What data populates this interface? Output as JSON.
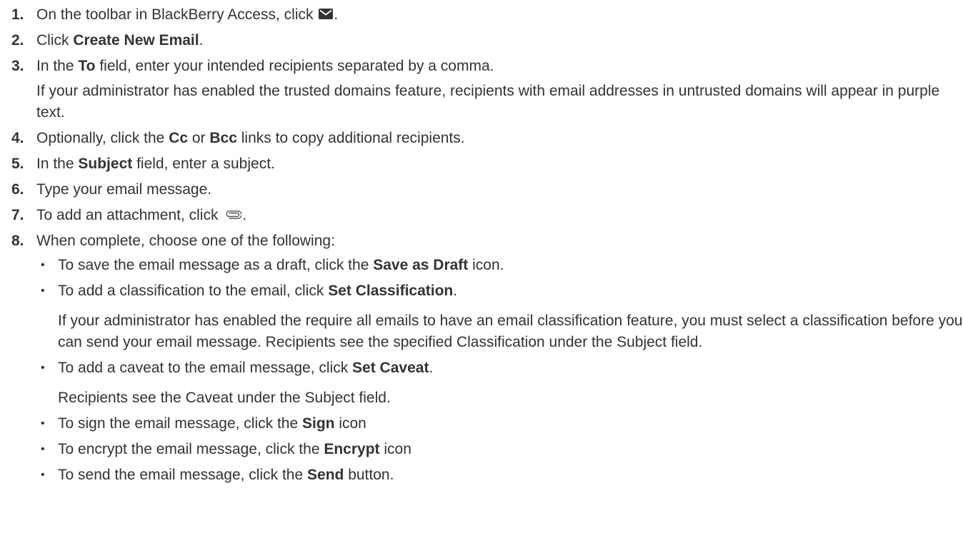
{
  "steps": [
    {
      "num": "1.",
      "a": "On the toolbar in BlackBerry Access, click ",
      "icon": "mail-icon",
      "b": "."
    },
    {
      "num": "2.",
      "a": "Click ",
      "bold1": "Create New Email",
      "b": "."
    },
    {
      "num": "3.",
      "a": "In the ",
      "bold1": "To",
      "b": " field, enter your intended recipients separated by a comma.",
      "note": "If your administrator has enabled the trusted domains feature, recipients with email addresses in untrusted domains will appear in purple text."
    },
    {
      "num": "4.",
      "a": "Optionally, click the ",
      "bold1": "Cc",
      "b": " or ",
      "bold2": "Bcc",
      "c": " links to copy additional recipients."
    },
    {
      "num": "5.",
      "a": "In the ",
      "bold1": "Subject",
      "b": " field, enter a subject."
    },
    {
      "num": "6.",
      "a": "Type your email message."
    },
    {
      "num": "7.",
      "a": "To add an attachment, click ",
      "icon": "paperclip-icon",
      "b": "."
    },
    {
      "num": "8.",
      "a": "When complete, choose one of the following:"
    }
  ],
  "options": [
    {
      "a": "To save the email message as a draft, click the ",
      "bold": "Save as Draft",
      "b": " icon."
    },
    {
      "a": "To add a classification to the email, click ",
      "bold": "Set Classification",
      "b": ".",
      "note": "If your administrator has enabled the require all emails to have an email classification feature, you must select a classification before you can send your email message. Recipients see the specified Classification under the Subject field."
    },
    {
      "a": "To add a caveat to the email message, click ",
      "bold": "Set Caveat",
      "b": ".",
      "note": "Recipients see the Caveat under the Subject field."
    },
    {
      "a": "To sign the email message, click the ",
      "bold": "Sign",
      "b": " icon"
    },
    {
      "a": "To encrypt the email message, click the ",
      "bold": "Encrypt",
      "b": " icon"
    },
    {
      "a": "To send the email message, click the ",
      "bold": "Send",
      "b": " button."
    }
  ],
  "bullet_char": "•",
  "colors": {
    "text": "#333333",
    "icon": "#333333"
  }
}
